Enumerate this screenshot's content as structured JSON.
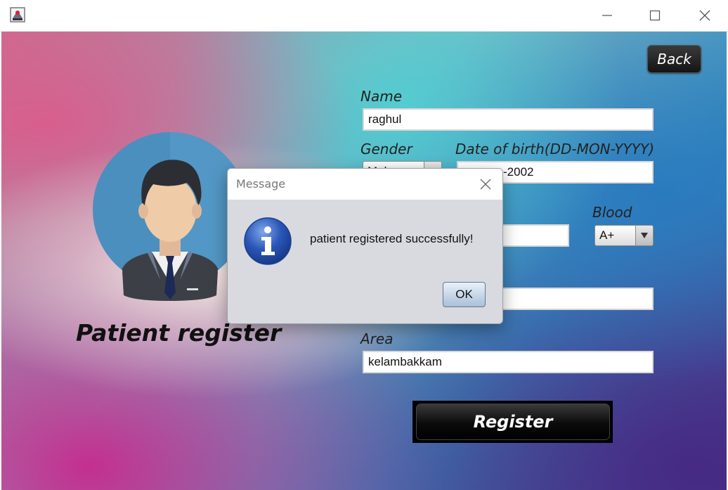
{
  "window": {
    "minimize_icon": "minimize-icon",
    "maximize_icon": "maximize-icon",
    "close_icon": "close-icon"
  },
  "form": {
    "back_label": "Back",
    "page_title": "Patient register",
    "name_label": "Name",
    "name_value": "raghul",
    "gender_label": "Gender",
    "gender_value": "Mal",
    "dob_label": "Date of birth(DD-MON-YYYY)",
    "dob_value": "-2002",
    "blood_label": "Blood",
    "blood_value": "A+",
    "area_label": "Area",
    "area_value": "kelambakkam",
    "register_label": "Register"
  },
  "dialog": {
    "title": "Message",
    "message": "patient registered successfully!",
    "ok_label": "OK",
    "icon": "info-icon"
  },
  "colors": {
    "button_dark": "#151515",
    "dialog_bg": "#d8dadf",
    "info_blue": "#2a57b8"
  }
}
